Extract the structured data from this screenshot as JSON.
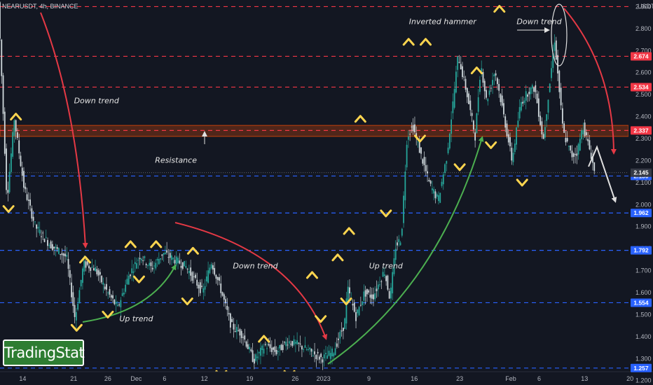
{
  "header": {
    "symbol": "NEARUSDT, 4h, BINANCE",
    "currency": "USDT"
  },
  "logo": {
    "text": "TradingStat"
  },
  "colors": {
    "bg": "#131722",
    "up": "#26a69a",
    "down": "#cfd8dc",
    "red_level": "#f23645",
    "blue_level": "#2962ff",
    "arrow_red": "#e53945",
    "arrow_green": "#4caf50",
    "marker": "#ffd54f",
    "zone": "#c2410c"
  },
  "chart_data": {
    "type": "candlestick",
    "title": "",
    "ylim": [
      1.18,
      2.93
    ],
    "y_ticks": [
      "1.200",
      "1.300",
      "1.400",
      "1.500",
      "1.600",
      "1.700",
      "1.800",
      "1.900",
      "2.000",
      "2.100",
      "2.200",
      "2.300",
      "2.400",
      "2.500",
      "2.600",
      "2.700",
      "2.800",
      "2.900"
    ],
    "x_ticks": [
      {
        "label": "14",
        "x": 0.04
      },
      {
        "label": "21",
        "x": 0.13
      },
      {
        "label": "26",
        "x": 0.19
      },
      {
        "label": "Dec",
        "x": 0.24
      },
      {
        "label": "6",
        "x": 0.29
      },
      {
        "label": "12",
        "x": 0.36
      },
      {
        "label": "19",
        "x": 0.44
      },
      {
        "label": "26",
        "x": 0.52
      },
      {
        "label": "2023",
        "x": 0.57
      },
      {
        "label": "9",
        "x": 0.65
      },
      {
        "label": "16",
        "x": 0.73
      },
      {
        "label": "23",
        "x": 0.81
      },
      {
        "label": "Feb",
        "x": 0.9
      },
      {
        "label": "6",
        "x": 0.95
      },
      {
        "label": "13",
        "x": 1.03
      },
      {
        "label": "20",
        "x": 1.11
      }
    ],
    "price_path": [
      [
        0.0,
        2.92
      ],
      [
        0.015,
        2.02
      ],
      [
        0.028,
        2.39
      ],
      [
        0.045,
        2.08
      ],
      [
        0.065,
        1.9
      ],
      [
        0.09,
        1.82
      ],
      [
        0.12,
        1.76
      ],
      [
        0.135,
        1.48
      ],
      [
        0.15,
        1.73
      ],
      [
        0.17,
        1.71
      ],
      [
        0.19,
        1.61
      ],
      [
        0.21,
        1.53
      ],
      [
        0.23,
        1.68
      ],
      [
        0.25,
        1.77
      ],
      [
        0.27,
        1.71
      ],
      [
        0.29,
        1.78
      ],
      [
        0.31,
        1.75
      ],
      [
        0.33,
        1.72
      ],
      [
        0.36,
        1.6
      ],
      [
        0.375,
        1.74
      ],
      [
        0.39,
        1.63
      ],
      [
        0.41,
        1.45
      ],
      [
        0.43,
        1.41
      ],
      [
        0.45,
        1.29
      ],
      [
        0.47,
        1.36
      ],
      [
        0.49,
        1.33
      ],
      [
        0.51,
        1.38
      ],
      [
        0.53,
        1.36
      ],
      [
        0.55,
        1.33
      ],
      [
        0.57,
        1.3
      ],
      [
        0.59,
        1.33
      ],
      [
        0.61,
        1.46
      ],
      [
        0.615,
        1.62
      ],
      [
        0.63,
        1.49
      ],
      [
        0.645,
        1.6
      ],
      [
        0.66,
        1.58
      ],
      [
        0.68,
        1.7
      ],
      [
        0.69,
        1.57
      ],
      [
        0.7,
        1.81
      ],
      [
        0.71,
        1.85
      ],
      [
        0.72,
        2.31
      ],
      [
        0.73,
        2.36
      ],
      [
        0.745,
        2.22
      ],
      [
        0.76,
        2.09
      ],
      [
        0.775,
        2.02
      ],
      [
        0.79,
        2.22
      ],
      [
        0.8,
        2.44
      ],
      [
        0.81,
        2.68
      ],
      [
        0.825,
        2.51
      ],
      [
        0.84,
        2.31
      ],
      [
        0.85,
        2.64
      ],
      [
        0.86,
        2.47
      ],
      [
        0.875,
        2.61
      ],
      [
        0.89,
        2.41
      ],
      [
        0.905,
        2.2
      ],
      [
        0.92,
        2.46
      ],
      [
        0.935,
        2.52
      ],
      [
        0.945,
        2.53
      ],
      [
        0.96,
        2.29
      ],
      [
        0.98,
        2.75
      ],
      [
        0.995,
        2.33
      ],
      [
        1.01,
        2.22
      ],
      [
        1.02,
        2.24
      ],
      [
        1.03,
        2.36
      ],
      [
        1.045,
        2.22
      ],
      [
        1.05,
        2.15
      ]
    ],
    "levels": [
      {
        "price": "2.900",
        "color": "#f23645",
        "tag": "",
        "dashed": true
      },
      {
        "price": "2.674",
        "color": "#f23645",
        "tag": "2.674",
        "dashed": true
      },
      {
        "price": "2.534",
        "color": "#f23645",
        "tag": "2.534",
        "dashed": true
      },
      {
        "price": "2.337",
        "color": "#f23645",
        "tag": "2.337",
        "dashed": true
      },
      {
        "price": "2.130",
        "color": "#2962ff",
        "tag": "2.130",
        "dashed": true
      },
      {
        "price": "1.962",
        "color": "#2962ff",
        "tag": "1.962",
        "dashed": true
      },
      {
        "price": "1.792",
        "color": "#2962ff",
        "tag": "1.792",
        "dashed": true
      },
      {
        "price": "1.554",
        "color": "#2962ff",
        "tag": "1.554",
        "dashed": true
      },
      {
        "price": "1.257",
        "color": "#2962ff",
        "tag": "1.257",
        "dashed": true
      }
    ],
    "current_price": "2.145",
    "resistance_zone": {
      "from": 2.31,
      "to": 2.36
    },
    "annotations": [
      {
        "text": "Down trend",
        "x": 0.17,
        "y": 2.46
      },
      {
        "text": "Resistance",
        "x": 0.31,
        "y": 2.19
      },
      {
        "text": "Up trend",
        "x": 0.24,
        "y": 1.47
      },
      {
        "text": "Down trend",
        "x": 0.45,
        "y": 1.71
      },
      {
        "text": "Up trend",
        "x": 0.68,
        "y": 1.71
      },
      {
        "text": "Inverted hammer",
        "x": 0.78,
        "y": 2.82
      },
      {
        "text": "Down trend",
        "x": 0.95,
        "y": 2.82
      }
    ],
    "markers": [
      {
        "dir": "down",
        "x": 0.015,
        "y": 1.98
      },
      {
        "dir": "up",
        "x": 0.028,
        "y": 2.4
      },
      {
        "dir": "down",
        "x": 0.135,
        "y": 1.44
      },
      {
        "dir": "up",
        "x": 0.15,
        "y": 1.75
      },
      {
        "dir": "down",
        "x": 0.19,
        "y": 1.5
      },
      {
        "dir": "up",
        "x": 0.23,
        "y": 1.82
      },
      {
        "dir": "down",
        "x": 0.245,
        "y": 1.66
      },
      {
        "dir": "up",
        "x": 0.275,
        "y": 1.82
      },
      {
        "dir": "up",
        "x": 0.34,
        "y": 1.79
      },
      {
        "dir": "down",
        "x": 0.33,
        "y": 1.56
      },
      {
        "dir": "down",
        "x": 0.39,
        "y": 1.23
      },
      {
        "dir": "up",
        "x": 0.465,
        "y": 1.39
      },
      {
        "dir": "down",
        "x": 0.51,
        "y": 1.23
      },
      {
        "dir": "up",
        "x": 0.55,
        "y": 1.68
      },
      {
        "dir": "down",
        "x": 0.565,
        "y": 1.48
      },
      {
        "dir": "up",
        "x": 0.595,
        "y": 1.76
      },
      {
        "dir": "down",
        "x": 0.61,
        "y": 1.56
      },
      {
        "dir": "up",
        "x": 0.615,
        "y": 1.88
      },
      {
        "dir": "up",
        "x": 0.635,
        "y": 2.39
      },
      {
        "dir": "down",
        "x": 0.68,
        "y": 1.96
      },
      {
        "dir": "up",
        "x": 0.72,
        "y": 2.74
      },
      {
        "dir": "down",
        "x": 0.74,
        "y": 2.3
      },
      {
        "dir": "up",
        "x": 0.75,
        "y": 2.74
      },
      {
        "dir": "down",
        "x": 0.81,
        "y": 2.17
      },
      {
        "dir": "up",
        "x": 0.84,
        "y": 2.61
      },
      {
        "dir": "down",
        "x": 0.865,
        "y": 2.27
      },
      {
        "dir": "up",
        "x": 0.88,
        "y": 2.89
      },
      {
        "dir": "down",
        "x": 0.92,
        "y": 2.1
      }
    ]
  }
}
